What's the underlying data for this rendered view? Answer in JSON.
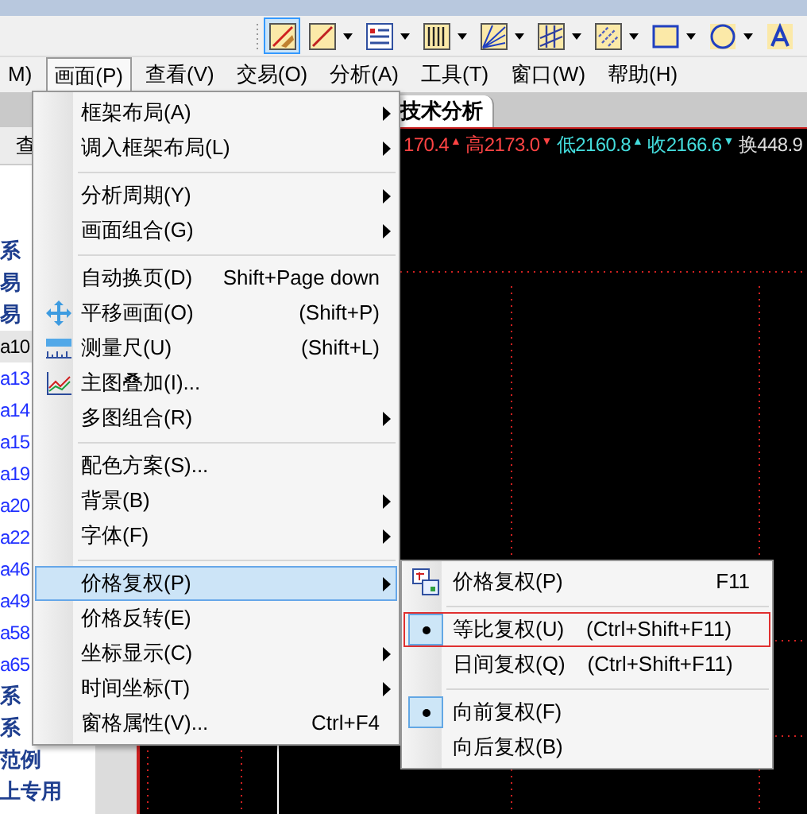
{
  "toolbar": {
    "tools": [
      {
        "kind": "pencil",
        "selected": true,
        "dropdown": false
      },
      {
        "kind": "line",
        "selected": false,
        "dropdown": true
      },
      {
        "kind": "list",
        "selected": false,
        "dropdown": true
      },
      {
        "kind": "bars",
        "selected": false,
        "dropdown": true
      },
      {
        "kind": "fan",
        "selected": false,
        "dropdown": true
      },
      {
        "kind": "parallel",
        "selected": false,
        "dropdown": true
      },
      {
        "kind": "hatch",
        "selected": false,
        "dropdown": true
      },
      {
        "kind": "rect",
        "selected": false,
        "dropdown": true
      },
      {
        "kind": "circle",
        "selected": false,
        "dropdown": true
      },
      {
        "kind": "text",
        "selected": false,
        "dropdown": false
      }
    ]
  },
  "menubar": {
    "items": [
      {
        "label": "M)",
        "selected": false
      },
      {
        "label": "画面(P)",
        "selected": true
      },
      {
        "label": "查看(V)",
        "selected": false
      },
      {
        "label": "交易(O)",
        "selected": false
      },
      {
        "label": "分析(A)",
        "selected": false
      },
      {
        "label": "工具(T)",
        "selected": false
      },
      {
        "label": "窗口(W)",
        "selected": false
      },
      {
        "label": "帮助(H)",
        "selected": false
      }
    ]
  },
  "tabs": [
    {
      "label": "技术分析",
      "selected": true
    }
  ],
  "sidebar": {
    "header": "查",
    "items": [
      {
        "text": "系",
        "kind": "group",
        "selected": false
      },
      {
        "text": "易",
        "kind": "group",
        "selected": false
      },
      {
        "text": "易",
        "kind": "group",
        "selected": false
      },
      {
        "text": "a10",
        "kind": "stock",
        "selected": true
      },
      {
        "text": "a13",
        "kind": "stock",
        "selected": false
      },
      {
        "text": "a14",
        "kind": "stock",
        "selected": false
      },
      {
        "text": "a15",
        "kind": "stock",
        "selected": false
      },
      {
        "text": "a19",
        "kind": "stock",
        "selected": false
      },
      {
        "text": "a20",
        "kind": "stock",
        "selected": false
      },
      {
        "text": "a22",
        "kind": "stock",
        "selected": false
      },
      {
        "text": "a46",
        "kind": "stock",
        "selected": false
      },
      {
        "text": "a49",
        "kind": "stock",
        "selected": false
      },
      {
        "text": "a58",
        "kind": "stock",
        "selected": false
      },
      {
        "text": "a65",
        "kind": "stock",
        "selected": false
      },
      {
        "text": "系",
        "kind": "group",
        "selected": false
      },
      {
        "text": "系",
        "kind": "group",
        "selected": false
      },
      {
        "text": "范例",
        "kind": "group",
        "selected": false
      },
      {
        "text": "上专用",
        "kind": "group",
        "selected": false
      }
    ]
  },
  "quote_line": [
    {
      "text": "170.4",
      "arrow": "▲",
      "color": "#ff4444"
    },
    {
      "text": "高2173.0",
      "arrow": "▼",
      "color": "#ff4444"
    },
    {
      "text": "低2160.8",
      "arrow": "▲",
      "color": "#44dddd"
    },
    {
      "text": "收2166.6",
      "arrow": "▼",
      "color": "#44dddd"
    },
    {
      "text": "换448.9",
      "color": "#dddddd"
    }
  ],
  "menu": {
    "items": [
      {
        "kind": "item",
        "label": "框架布局(A)",
        "submenu": true,
        "selected": false
      },
      {
        "kind": "item",
        "label": "调入框架布局(L)",
        "submenu": true,
        "selected": false
      },
      {
        "kind": "separator"
      },
      {
        "kind": "item",
        "label": "分析周期(Y)",
        "submenu": true,
        "selected": false
      },
      {
        "kind": "item",
        "label": "画面组合(G)",
        "submenu": true,
        "selected": false
      },
      {
        "kind": "separator"
      },
      {
        "kind": "item",
        "label": "自动换页(D)",
        "shortcut": "Shift+Page down",
        "submenu": false,
        "selected": false
      },
      {
        "kind": "item",
        "label": "平移画面(O)",
        "shortcut": "(Shift+P)",
        "submenu": false,
        "selected": false
      },
      {
        "kind": "item",
        "label": "测量尺(U)",
        "shortcut": "(Shift+L)",
        "submenu": false,
        "selected": false
      },
      {
        "kind": "item",
        "label": "主图叠加(I)...",
        "submenu": false,
        "selected": false
      },
      {
        "kind": "item",
        "label": "多图组合(R)",
        "submenu": true,
        "selected": false
      },
      {
        "kind": "separator"
      },
      {
        "kind": "item",
        "label": "配色方案(S)...",
        "submenu": false,
        "selected": false
      },
      {
        "kind": "item",
        "label": "背景(B)",
        "submenu": true,
        "selected": false
      },
      {
        "kind": "item",
        "label": "字体(F)",
        "submenu": true,
        "selected": false
      },
      {
        "kind": "separator"
      },
      {
        "kind": "item",
        "label": "价格复权(P)",
        "submenu": true,
        "selected": true
      },
      {
        "kind": "item",
        "label": "价格反转(E)",
        "submenu": false,
        "selected": false
      },
      {
        "kind": "item",
        "label": "坐标显示(C)",
        "submenu": true,
        "selected": false
      },
      {
        "kind": "item",
        "label": "时间坐标(T)",
        "submenu": true,
        "selected": false
      },
      {
        "kind": "item",
        "label": "窗格属性(V)...",
        "shortcut": "Ctrl+F4",
        "submenu": false,
        "selected": false
      }
    ]
  },
  "submenu": {
    "items": [
      {
        "kind": "item",
        "label": "价格复权(P)",
        "shortcut": "F11",
        "checked": false,
        "focused": false
      },
      {
        "kind": "separator"
      },
      {
        "kind": "item",
        "label": "等比复权(U)",
        "shortcut": "(Ctrl+Shift+F11)",
        "checked": true,
        "focused": true
      },
      {
        "kind": "item",
        "label": "日间复权(Q)",
        "shortcut": "(Ctrl+Shift+F11)",
        "checked": false,
        "focused": false
      },
      {
        "kind": "separator"
      },
      {
        "kind": "item",
        "label": "向前复权(F)",
        "checked": true,
        "focused": false
      },
      {
        "kind": "item",
        "label": "向后复权(B)",
        "checked": false,
        "focused": false
      }
    ]
  }
}
